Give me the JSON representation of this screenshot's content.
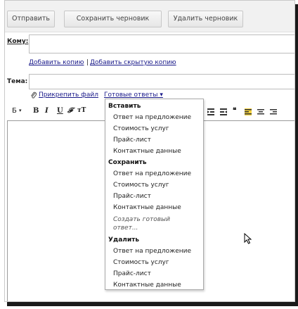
{
  "toolbar": {
    "send": "Отправить",
    "save_draft": "Сохранить черновик",
    "delete_draft": "Удалить черновик"
  },
  "to": {
    "label": "Кому:",
    "value": ""
  },
  "cc_links": {
    "add_cc": "Добавить копию",
    "separator": "|",
    "add_bcc": "Добавить скрытую копию"
  },
  "subject": {
    "label": "Тема:",
    "value": ""
  },
  "attach": {
    "label": "Прикрепить файл"
  },
  "canned": {
    "label": "Готовые ответы ▾"
  },
  "format": {
    "font": "Б",
    "bold": "B",
    "italic": "I",
    "underline": "U",
    "font_style": "𝓕",
    "size": "тТ",
    "quote": "❝"
  },
  "menu": {
    "insert": {
      "heading": "Вставить",
      "items": [
        "Ответ на предложение",
        "Стоимость услуг",
        "Прайс-лист",
        "Контактные данные"
      ]
    },
    "save": {
      "heading": "Сохранить",
      "items": [
        "Ответ на предложение",
        "Стоимость услуг",
        "Прайс-лист",
        "Контактные данные"
      ],
      "create_line1": "Создать готовый",
      "create_line2": "ответ..."
    },
    "delete": {
      "heading": "Удалить",
      "items": [
        "Ответ на предложение",
        "Стоимость услуг",
        "Прайс-лист",
        "Контактные данные"
      ]
    }
  },
  "colors": {
    "link": "#1a1a8a",
    "button_border": "#c7c7c7",
    "highlight": "#f5d33c"
  }
}
